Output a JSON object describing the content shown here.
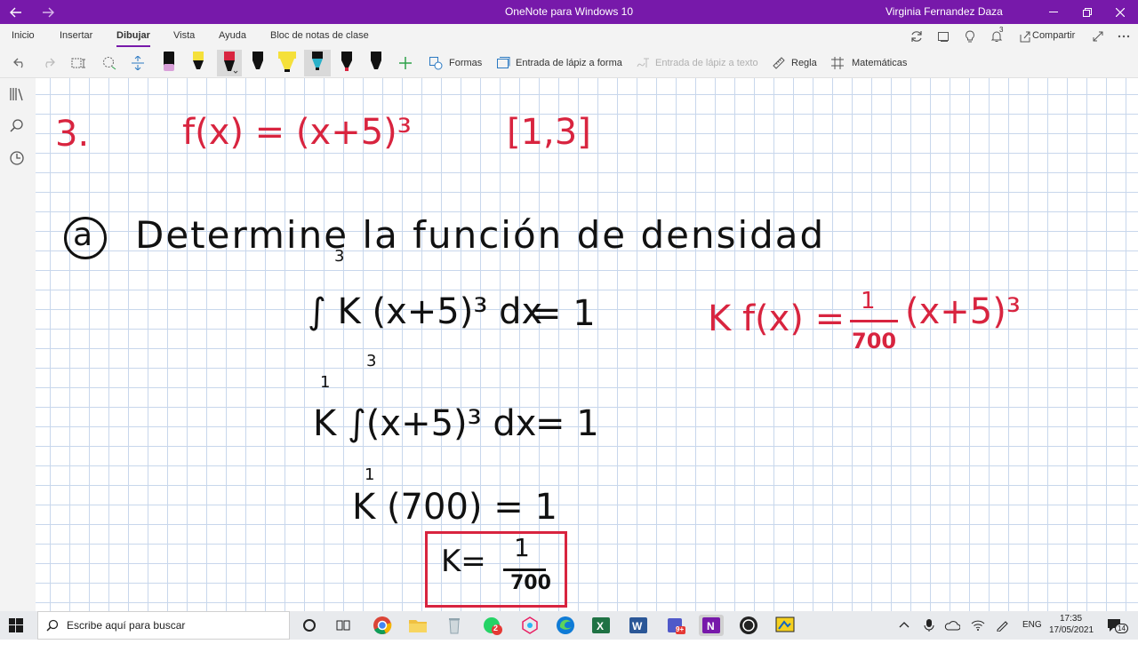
{
  "window": {
    "title": "OneNote para Windows 10",
    "user": "Virginia Fernandez Daza"
  },
  "tabs": [
    {
      "label": "Inicio"
    },
    {
      "label": "Insertar"
    },
    {
      "label": "Dibujar",
      "active": true
    },
    {
      "label": "Vista"
    },
    {
      "label": "Ayuda"
    },
    {
      "label": "Bloc de notas de clase"
    }
  ],
  "share_label": "Compartir",
  "notification_count": "3",
  "toolbar": {
    "forms": "Formas",
    "ink_to_shape": "Entrada de lápiz a forma",
    "ink_to_text": "Entrada de lápiz a texto",
    "ruler": "Regla",
    "math": "Matemáticas"
  },
  "pens": [
    {
      "color": "#d9a0d9",
      "tip": "#111"
    },
    {
      "color": "#f5e03a",
      "tip": "#111"
    },
    {
      "color": "#d8243f",
      "tip": "#111",
      "selected": true
    },
    {
      "color": "#111111",
      "tip": "#111"
    },
    {
      "color": "#f5e03a",
      "tip": "#f5e03a"
    },
    {
      "color": "#2ab0c8",
      "tip": "#111",
      "selected": true
    },
    {
      "color": "#d8243f",
      "tip": "#111"
    },
    {
      "color": "#111111",
      "tip": "#111"
    }
  ],
  "ink": {
    "problem_number": "3.",
    "function": "f(x) = (x+5)³",
    "interval": "[1,3]",
    "part_label": "a",
    "instruction": "Determine la función de densidad",
    "eq1_lhs": "∫ K (x+5)³ dx",
    "eq1_rhs": "= 1",
    "eq1_upper": "3",
    "eq1_lower": "1",
    "eq2_lhs": "K ∫(x+5)³ dx",
    "eq2_rhs": "= 1",
    "eq2_upper": "3",
    "eq2_lower": "1",
    "eq3": "K (700) = 1",
    "k_label": "K=",
    "k_num": "1",
    "k_den": "700",
    "density_lhs": "K f(x) =",
    "density_num": "1",
    "density_den": "700",
    "density_rhs": "(x+5)³",
    "colors": {
      "red": "#d8243f",
      "black": "#111111"
    }
  },
  "taskbar": {
    "search_placeholder": "Escribe aquí para buscar",
    "lang": "ENG",
    "time": "17:35",
    "date": "17/05/2021",
    "notif_count": "14",
    "chrome_badge": "2",
    "teams_badge": "9+"
  }
}
